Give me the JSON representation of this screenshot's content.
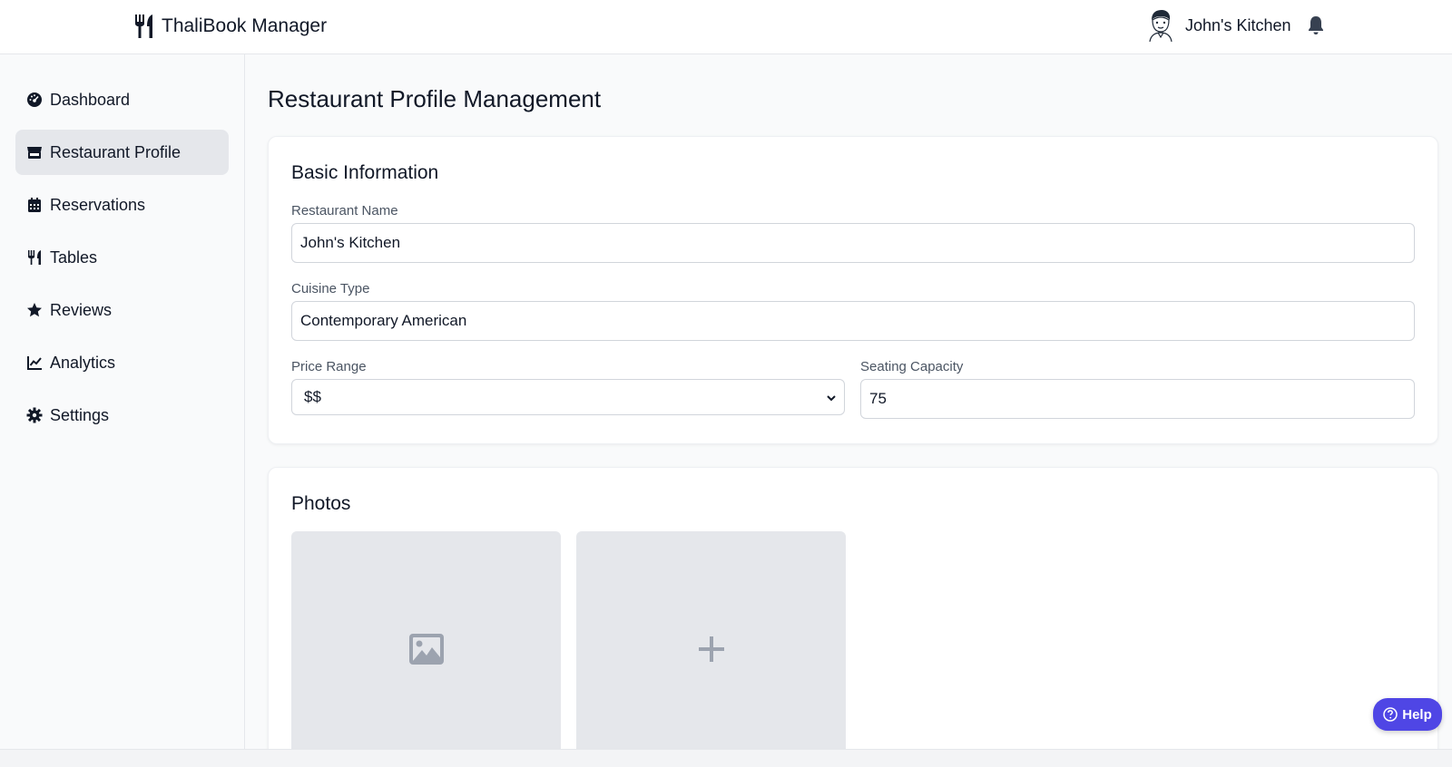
{
  "header": {
    "app_name": "ThaliBook Manager",
    "user_name": "John's Kitchen",
    "icons": [
      "utensils-icon",
      "avatar",
      "bell-icon"
    ]
  },
  "sidebar": {
    "active": "Restaurant Profile",
    "items": [
      {
        "label": "Dashboard",
        "icon": "dashboard-icon"
      },
      {
        "label": "Restaurant Profile",
        "icon": "store-icon"
      },
      {
        "label": "Reservations",
        "icon": "calendar-icon"
      },
      {
        "label": "Tables",
        "icon": "utensils-icon"
      },
      {
        "label": "Reviews",
        "icon": "star-icon"
      },
      {
        "label": "Analytics",
        "icon": "chart-line-icon"
      },
      {
        "label": "Settings",
        "icon": "gear-icon"
      }
    ]
  },
  "main": {
    "title": "Restaurant Profile Management",
    "basic_info": {
      "title": "Basic Information",
      "restaurant_name_label": "Restaurant Name",
      "restaurant_name_value": "John's Kitchen",
      "cuisine_label": "Cuisine Type",
      "cuisine_value": "Contemporary American",
      "price_label": "Price Range",
      "price_value": "$$",
      "seating_label": "Seating Capacity",
      "seating_value": "75"
    },
    "photos": {
      "title": "Photos",
      "tiles": [
        {
          "icon": "image-icon"
        },
        {
          "icon": "plus-icon"
        }
      ]
    }
  },
  "help": {
    "label": "Help",
    "icon": "question-circle-icon"
  },
  "colors": {
    "accent": "#4f46e5",
    "active_nav": "#e5e7eb",
    "tile_bg": "#e5e7eb",
    "placeholder_icon": "#9ca3af"
  }
}
